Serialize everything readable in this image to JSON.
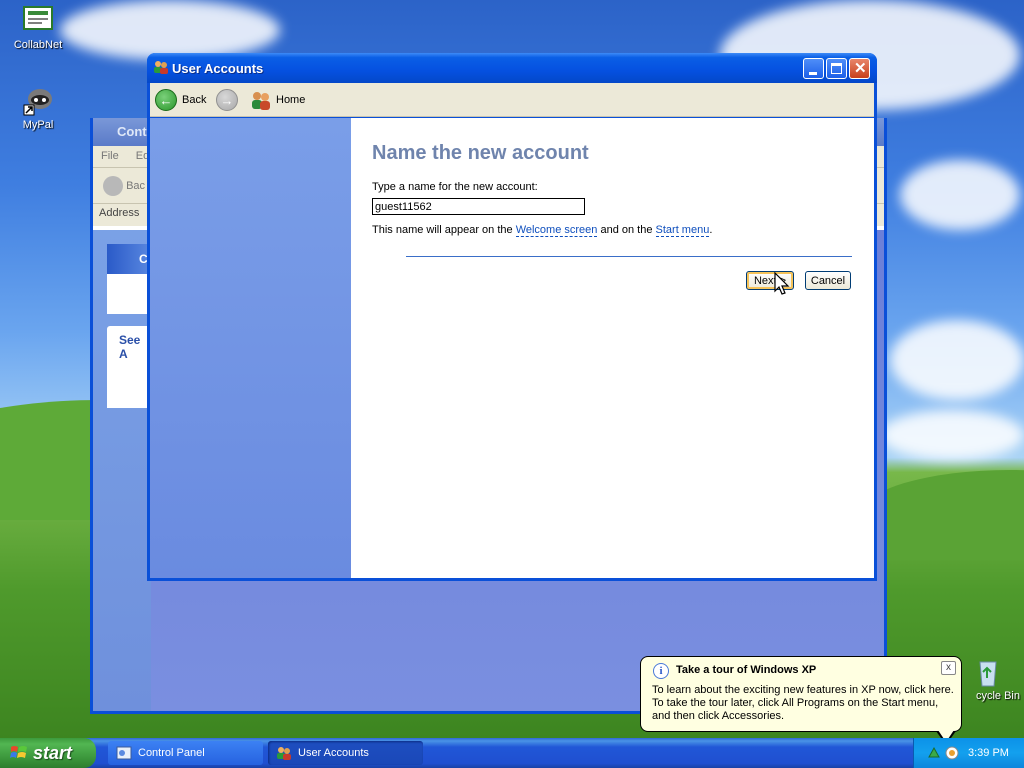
{
  "desktop": {
    "icons": [
      {
        "label": "CollabNet"
      },
      {
        "label": "MyPal"
      },
      {
        "label": "cycle Bin"
      }
    ]
  },
  "control_panel": {
    "title": "Contr",
    "menu": [
      "File",
      "Ed"
    ],
    "back_label": "Bac",
    "address_label": "Address",
    "panel_header": "Co",
    "see_also": "See A"
  },
  "window": {
    "title": "User Accounts",
    "nav": {
      "back": "Back",
      "home": "Home"
    }
  },
  "content": {
    "heading": "Name the new account",
    "prompt": "Type a name for the new account:",
    "account_name": "guest11562",
    "info_prefix": "This name will appear on the ",
    "link_welcome": "Welcome screen",
    "info_middle": " and on the ",
    "link_start": "Start menu",
    "info_suffix": ".",
    "next_label": "Next >",
    "cancel_label": "Cancel"
  },
  "balloon": {
    "title": "Take a tour of Windows XP",
    "body": "To learn about the exciting new features in XP now, click here. To take the tour later, click All Programs on the Start menu, and then click Accessories.",
    "close": "x"
  },
  "taskbar": {
    "start_label": "start",
    "tasks": [
      {
        "label": "Control Panel"
      },
      {
        "label": "User Accounts"
      }
    ],
    "clock": "3:39 PM"
  },
  "colors": {
    "heading": "#6f84ad",
    "link": "#0f4fbd",
    "title_bar": "#0550e0",
    "sidebar": "#6a8be0"
  }
}
